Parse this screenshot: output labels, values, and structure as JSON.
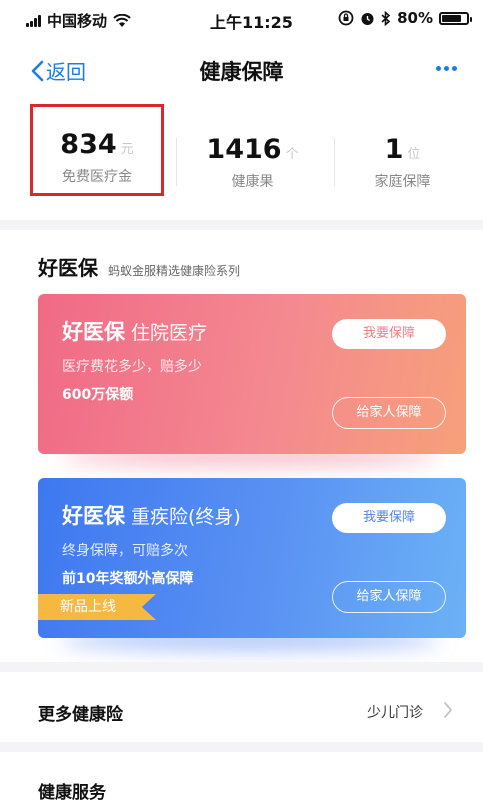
{
  "status_bar": {
    "carrier": "中国移动",
    "time": "上午11:25",
    "battery": "80%",
    "battery_level": 0.8
  },
  "nav": {
    "back_label": "返回",
    "title": "健康保障",
    "more_icon": "more-dots-icon"
  },
  "stats": [
    {
      "value": "834",
      "unit": "元",
      "label": "免费医疗金"
    },
    {
      "value": "1416",
      "unit": "个",
      "label": "健康果"
    },
    {
      "value": "1",
      "unit": "位",
      "label": "家庭保障"
    }
  ],
  "section": {
    "title": "好医保",
    "subtitle": "蚂蚁金服精选健康险系列"
  },
  "cards": [
    {
      "brand": "好医保",
      "product": "住院医疗",
      "line1": "医疗费花多少，赔多少",
      "line2": "600万保额",
      "primary_button": "我要保障",
      "secondary_button": "给家人保障",
      "color": "#f06a86"
    },
    {
      "brand": "好医保",
      "product": "重疾险(终身)",
      "line1": "终身保障，可赔多次",
      "line2": "前10年奖额外高保障",
      "primary_button": "我要保障",
      "secondary_button": "给家人保障",
      "ribbon": "新品上线",
      "color": "#3e78f0"
    }
  ],
  "more_insurance": {
    "label": "更多健康险",
    "right_text": "少儿门诊"
  },
  "health_services": {
    "label": "健康服务"
  },
  "colors": {
    "accent": "#1a7ee6",
    "highlight_border": "#d9272e",
    "ribbon": "#f5b942"
  }
}
